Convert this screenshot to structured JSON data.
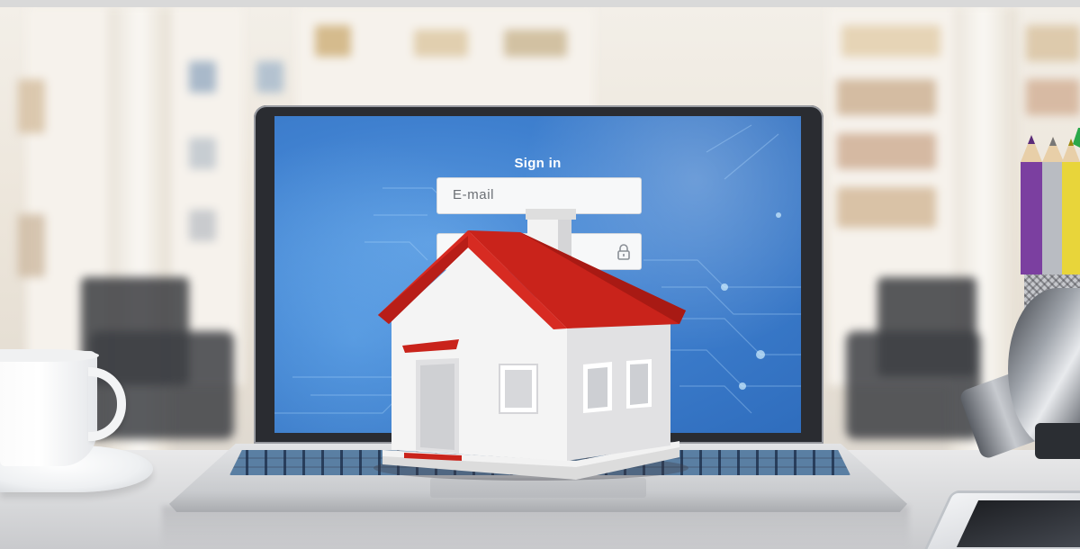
{
  "signin_form": {
    "title": "Sign in",
    "email_placeholder": "E-mail",
    "password_placeholder": ""
  },
  "scene_objects": {
    "laptop": "laptop",
    "house": "house-model",
    "cup": "coffee-cup",
    "pencils": "pencil-holder",
    "lamp": "desk-lamp",
    "tablet": "tablet"
  },
  "colors": {
    "screen_blue": "#3f80cf",
    "roof_red": "#c9231b",
    "house_wall": "#f4f4f4",
    "input_bg": "#f7f8f9"
  }
}
